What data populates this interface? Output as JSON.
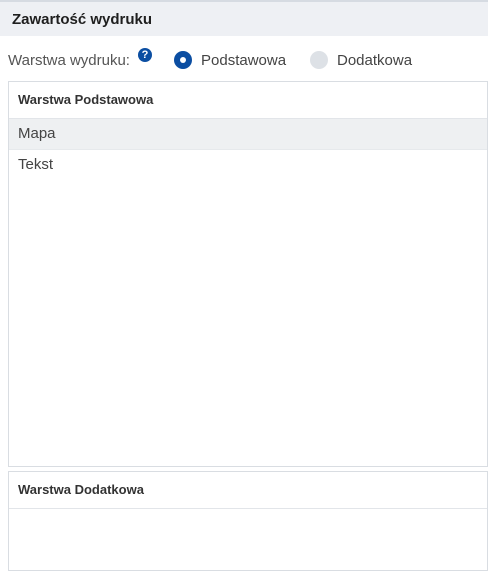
{
  "header": {
    "title": "Zawartość wydruku"
  },
  "layer_selector": {
    "label": "Warstwa wydruku:",
    "help_icon": "?",
    "options": [
      {
        "label": "Podstawowa",
        "checked": true
      },
      {
        "label": "Dodatkowa",
        "checked": false
      }
    ]
  },
  "basic_panel": {
    "title": "Warstwa Podstawowa",
    "items": [
      {
        "label": "Mapa",
        "selected": true
      },
      {
        "label": "Tekst",
        "selected": false
      }
    ]
  },
  "extra_panel": {
    "title": "Warstwa Dodatkowa",
    "items": []
  },
  "colors": {
    "accent": "#0b4ea2",
    "header_bg": "#eef0f4",
    "selected_row_bg": "#eef0f2"
  }
}
